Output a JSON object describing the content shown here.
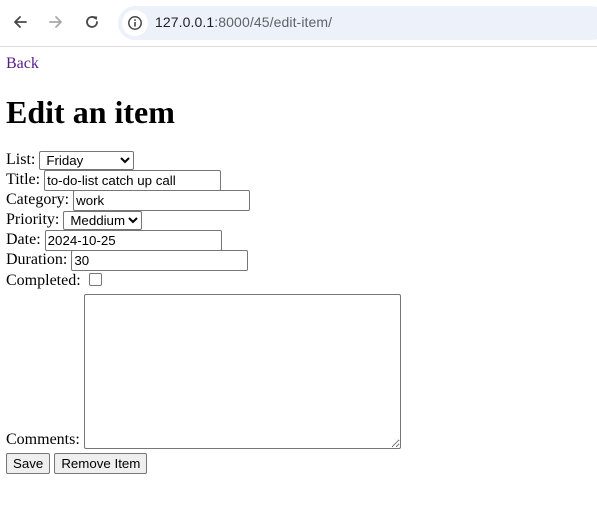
{
  "browser": {
    "url_host": "127.0.0.1",
    "url_rest": ":8000/45/edit-item/"
  },
  "page": {
    "back_link": "Back",
    "title": "Edit an item"
  },
  "form": {
    "list_label": "List:",
    "list_value": "Friday",
    "title_label": "Title:",
    "title_value": "to-do-list catch up call",
    "category_label": "Category:",
    "category_value": "work",
    "priority_label": "Priority:",
    "priority_value": "Meddium",
    "date_label": "Date:",
    "date_value": "2024-10-25",
    "duration_label": "Duration:",
    "duration_value": "30",
    "completed_label": "Completed:",
    "completed_checked": false,
    "comments_label": "Comments:",
    "comments_value": ""
  },
  "buttons": {
    "save": "Save",
    "remove": "Remove Item"
  }
}
